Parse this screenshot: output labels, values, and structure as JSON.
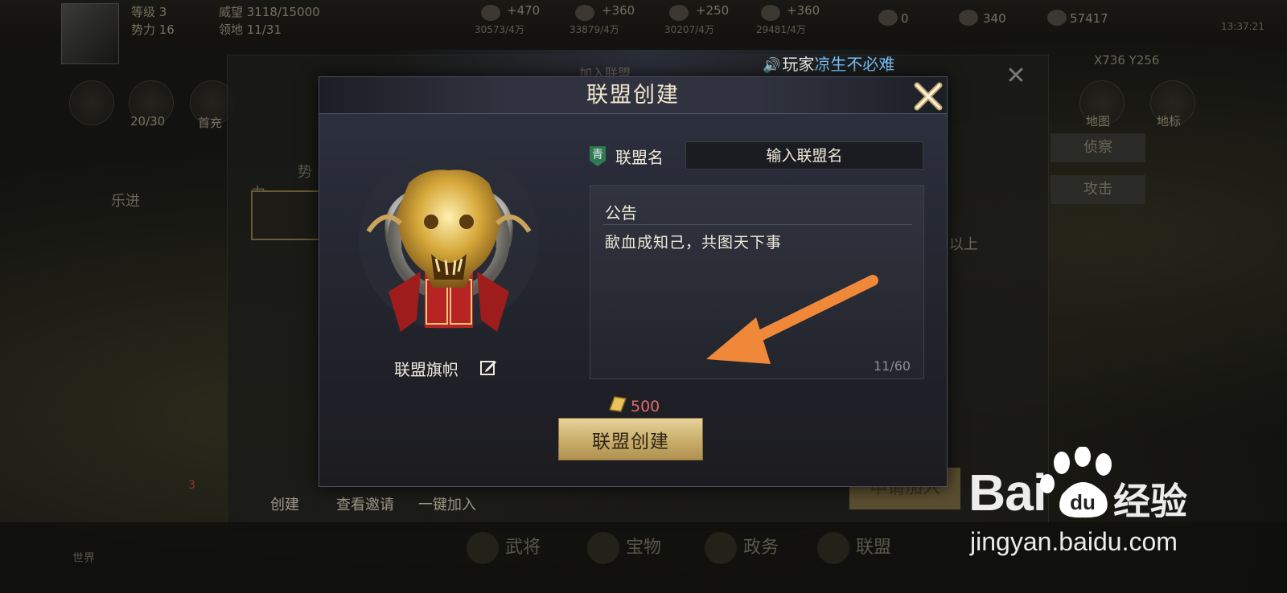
{
  "top_bar": {
    "level": "等级 3",
    "power": "势力 16",
    "prestige": "威望 3118/15000",
    "territory": "领地 11/31",
    "resources": [
      {
        "name": "wood",
        "rate": "+470",
        "amount": "30573/4万"
      },
      {
        "name": "iron",
        "rate": "+360",
        "amount": "33879/4万"
      },
      {
        "name": "stone",
        "rate": "+250",
        "amount": "30207/4万"
      },
      {
        "name": "grain",
        "rate": "+360",
        "amount": "29481/4万"
      }
    ],
    "gold": "0",
    "jade": "340",
    "copper": "57417",
    "clock": "13:37:21"
  },
  "sidebar": {
    "activity_count": "20/30",
    "first_charge": "首充",
    "map": "地图",
    "coords": "地标"
  },
  "under_panel": {
    "header": "加入联盟",
    "coords": "X736 Y256",
    "tab_power": "势力",
    "leader": "乐进",
    "scout": "侦察",
    "attack": "攻击",
    "above": "以上",
    "create": "创建",
    "view_invites": "查看邀请",
    "quick_join": "一键加入",
    "apply_join": "申请加入"
  },
  "broadcast": {
    "prefix": "玩家",
    "player": "凉生不必难"
  },
  "dialog": {
    "title": "联盟创建",
    "flag_label": "联盟旗帜",
    "rank_badge": "青",
    "name_label": "联盟名",
    "name_placeholder": "输入联盟名",
    "notice_title": "公告",
    "notice_text": "歃血成知己，共图天下事",
    "notice_count": "11/60",
    "cost": "500",
    "create_button": "联盟创建"
  },
  "bottom_bar": {
    "tabs": [
      "武将",
      "宝物",
      "政务",
      "联盟"
    ],
    "mail_badge": "3",
    "chat_label": "世界"
  },
  "watermark": {
    "logo": "Bai",
    "logo2": "经验",
    "url": "jingyan.baidu.com"
  }
}
